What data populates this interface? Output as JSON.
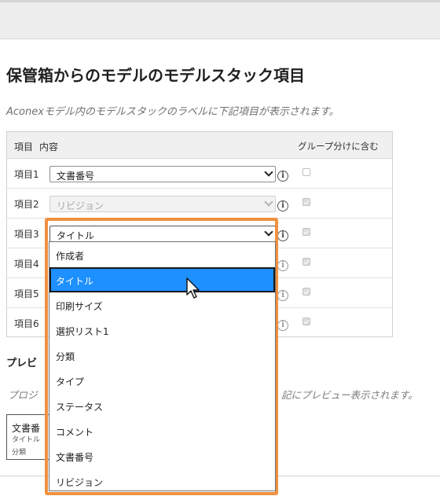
{
  "page": {
    "title": "保管箱からのモデルのモデルスタック項目",
    "description": "Aconexモデル内のモデルスタックのラベルに下記項目が表示されます。"
  },
  "table": {
    "headers": {
      "item": "項目",
      "content": "内容",
      "group": "グループ分けに含む"
    },
    "rows": [
      {
        "label": "項目1",
        "value": "文書番号",
        "disabled": false,
        "open": false,
        "group_checked": false,
        "group_disabled": false
      },
      {
        "label": "項目2",
        "value": "リビジョン",
        "disabled": true,
        "open": false,
        "group_checked": true,
        "group_disabled": true
      },
      {
        "label": "項目3",
        "value": "タイトル",
        "disabled": false,
        "open": true,
        "group_checked": true,
        "group_disabled": true
      },
      {
        "label": "項目4",
        "value": "",
        "disabled": false,
        "open": false,
        "group_checked": true,
        "group_disabled": true
      },
      {
        "label": "項目5",
        "value": "",
        "disabled": false,
        "open": false,
        "group_checked": true,
        "group_disabled": true
      },
      {
        "label": "項目6",
        "value": "",
        "disabled": false,
        "open": false,
        "group_checked": true,
        "group_disabled": true
      }
    ]
  },
  "dropdown": {
    "options": [
      "作成者",
      "タイトル",
      "印刷サイズ",
      "選択リスト1",
      "分類",
      "タイプ",
      "ステータス",
      "コメント",
      "文書番号",
      "リビジョン"
    ],
    "selected_index": 1
  },
  "preview": {
    "heading_visible": "プレビ",
    "description_head_visible": "プロジ",
    "description_tail_visible": "記にプレビュー表示されます。",
    "card_lines": [
      "文書番",
      "タイトル",
      "分類"
    ]
  },
  "icons": {
    "info": "info-circle-icon",
    "chevron": "chevron-down-icon",
    "cursor": "mouse-pointer-icon"
  },
  "colors": {
    "highlight_border": "#ef9140",
    "selected_option_bg": "#1e90ff",
    "table_header_bg": "#f0f0f0",
    "topbar_bg": "#ededed"
  }
}
